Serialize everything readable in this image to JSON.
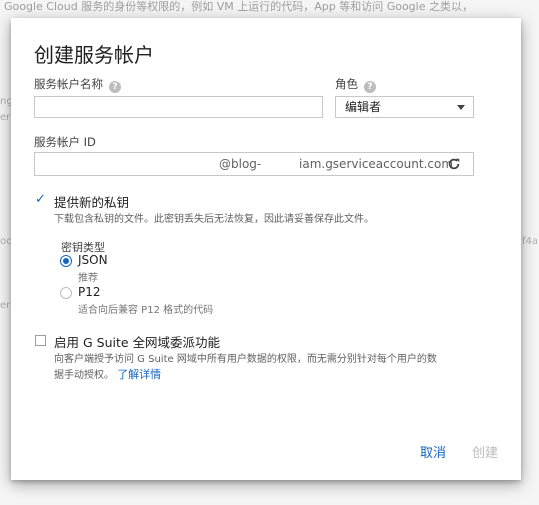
{
  "background": {
    "top_text": "Google Cloud 服务的身份等权限的，例如 VM 上运行的代码，App 等和访问 Google 之类以，",
    "left_fragments": [
      "ng",
      "er",
      "oc",
      "er"
    ],
    "right_fragment": "f4a"
  },
  "dialog": {
    "title": "创建服务帐户",
    "name_field": {
      "label": "服务帐户名称",
      "value": ""
    },
    "role_field": {
      "label": "角色",
      "selected": "编辑者"
    },
    "id_field": {
      "label": "服务帐户 ID",
      "prefix": "@blog-",
      "domain": "iam.gserviceaccount.com"
    },
    "new_key": {
      "label": "提供新的私钥",
      "checked": true,
      "description": "下载包含私钥的文件。此密钥丢失后无法恢复，因此请妥善保存此文件。",
      "key_type_label": "密钥类型",
      "options": [
        {
          "label": "JSON",
          "hint": "推荐",
          "selected": true
        },
        {
          "label": "P12",
          "hint": "适合向后兼容 P12 格式的代码",
          "selected": false
        }
      ]
    },
    "gsuite": {
      "label": "启用 G Suite 全网域委派功能",
      "checked": false,
      "description_line1": "向客户端授予访问 G Suite 网域中所有用户数据的权限，而无需分别针对每个用户的数",
      "description_line2": "据手动授权。",
      "learn_more": "了解详情"
    },
    "actions": {
      "cancel": "取消",
      "create": "创建"
    }
  },
  "colors": {
    "accent": "#1565c0",
    "disabled": "#bdbdbd"
  },
  "icons": {
    "help": "help-icon",
    "refresh": "refresh-icon",
    "dropdown": "chevron-down-icon",
    "check": "check-icon"
  }
}
